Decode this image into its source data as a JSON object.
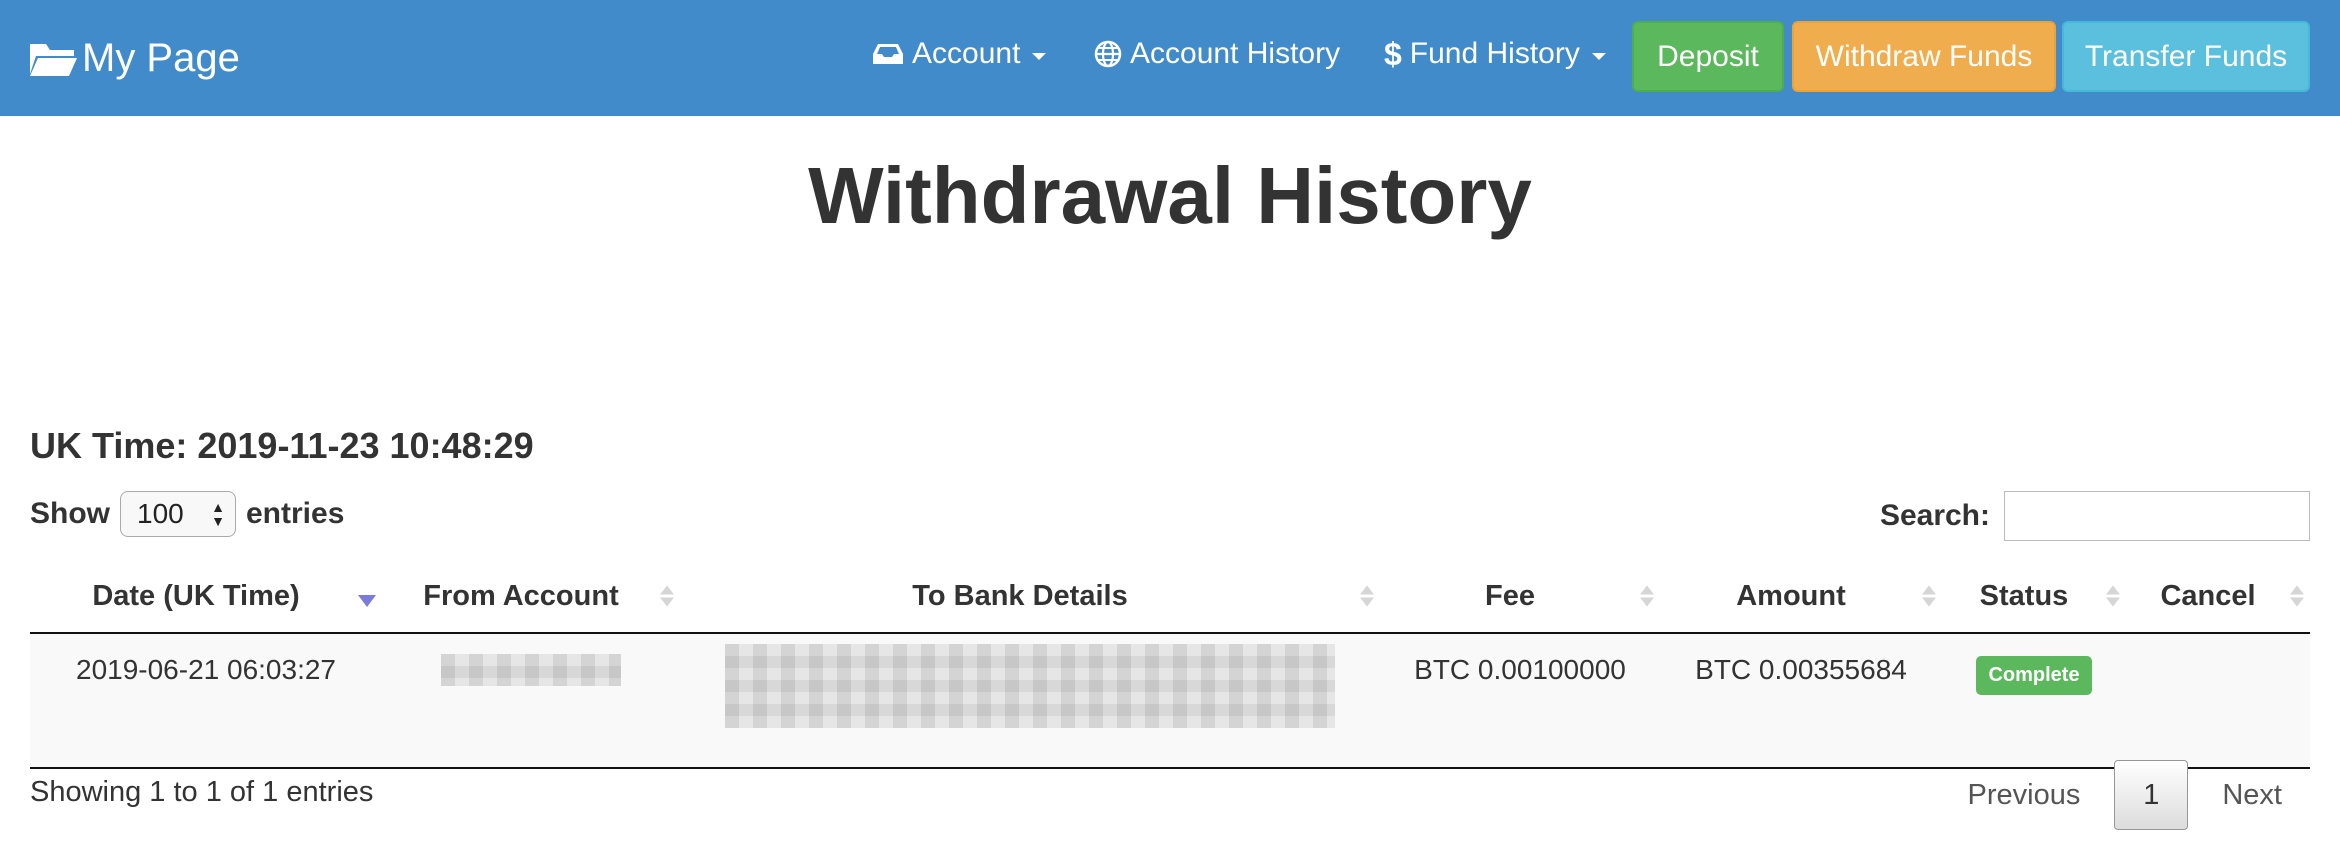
{
  "navbar": {
    "brand": "My Page",
    "brand_icon": "folder-open-icon",
    "links": [
      {
        "label": "Account",
        "icon": "inbox-icon",
        "dropdown": true
      },
      {
        "label": "Account History",
        "icon": "globe-icon",
        "dropdown": false
      },
      {
        "label": "Fund History",
        "icon": "dollar-icon",
        "icon_glyph": "$",
        "dropdown": true
      }
    ],
    "buttons": {
      "deposit": "Deposit",
      "withdraw": "Withdraw Funds",
      "transfer": "Transfer Funds"
    },
    "colors": {
      "bar": "#428bca",
      "deposit": "#5cb85c",
      "withdraw": "#f0ad4e",
      "transfer": "#5bc0de"
    }
  },
  "page": {
    "title": "Withdrawal History",
    "uk_time_label": "UK Time:",
    "uk_time_value": "2019-11-23 10:48:29"
  },
  "table_controls": {
    "show_label": "Show",
    "entries_label": "entries",
    "length_selected": "100",
    "search_label": "Search:",
    "search_value": ""
  },
  "table": {
    "columns": [
      "Date (UK Time)",
      "From Account",
      "To Bank Details",
      "Fee",
      "Amount",
      "Status",
      "Cancel"
    ],
    "sorted_column": 0,
    "rows": [
      {
        "date": "2019-06-21 06:03:27",
        "from_account": "",
        "to_bank_details": "",
        "fee": "BTC 0.00100000",
        "amount": "BTC 0.00355684",
        "status": "Complete",
        "status_color": "#5cb85c",
        "cancel": ""
      }
    ]
  },
  "footer": {
    "info": "Showing 1 to 1 of 1 entries",
    "previous": "Previous",
    "current_page": "1",
    "next": "Next"
  }
}
